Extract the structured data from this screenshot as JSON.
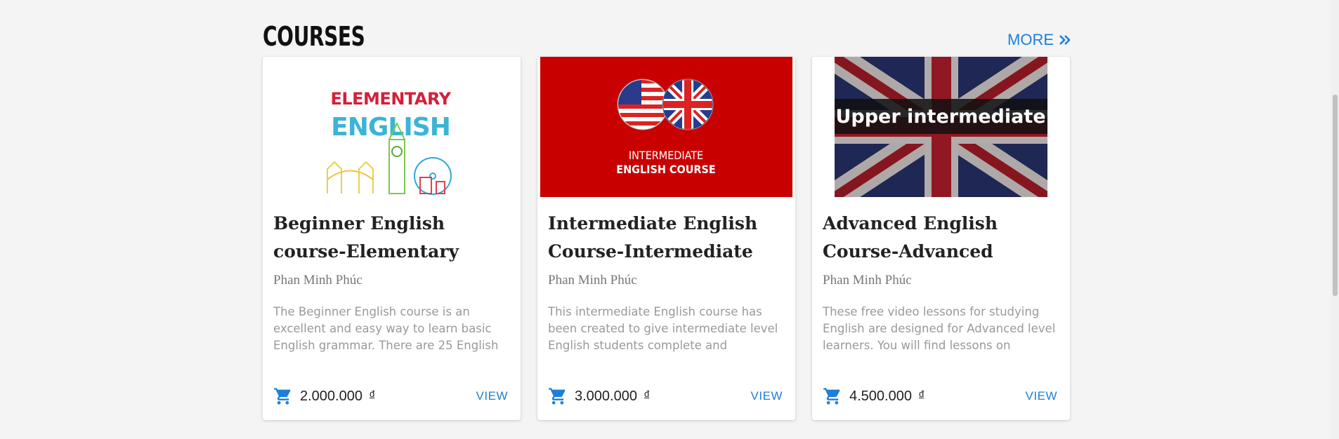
{
  "section": {
    "title": "COURSES",
    "more_label": "MORE"
  },
  "courses": [
    {
      "thumb_top": "ELEMENTARY",
      "thumb_bottom": "ENGLISH",
      "title": "Beginner English course-Elementary",
      "author": "Phan Minh Phúc",
      "description": "The Beginner English course is an excellent and easy way to learn basic English grammar. There are 25 English",
      "price": "2.000.000",
      "currency": "đ",
      "view_label": "VIEW"
    },
    {
      "thumb_top": "INTERMEDIATE",
      "thumb_bottom": "ENGLISH COURSE",
      "title": "Intermediate English Course-Intermediate",
      "author": "Phan Minh Phúc",
      "description": "This intermediate English course has been created to give intermediate level English students complete and",
      "price": "3.000.000",
      "currency": "đ",
      "view_label": "VIEW"
    },
    {
      "thumb_top": "Upper intermediate",
      "title": "Advanced English Course-Advanced",
      "author": "Phan Minh Phúc",
      "description": "These free video lessons for studying English are designed for Advanced level learners. You will find lessons on",
      "price": "4.500.000",
      "currency": "đ",
      "view_label": "VIEW"
    }
  ],
  "colors": {
    "accent": "#1e7fd8",
    "red_banner": "#c90000"
  }
}
